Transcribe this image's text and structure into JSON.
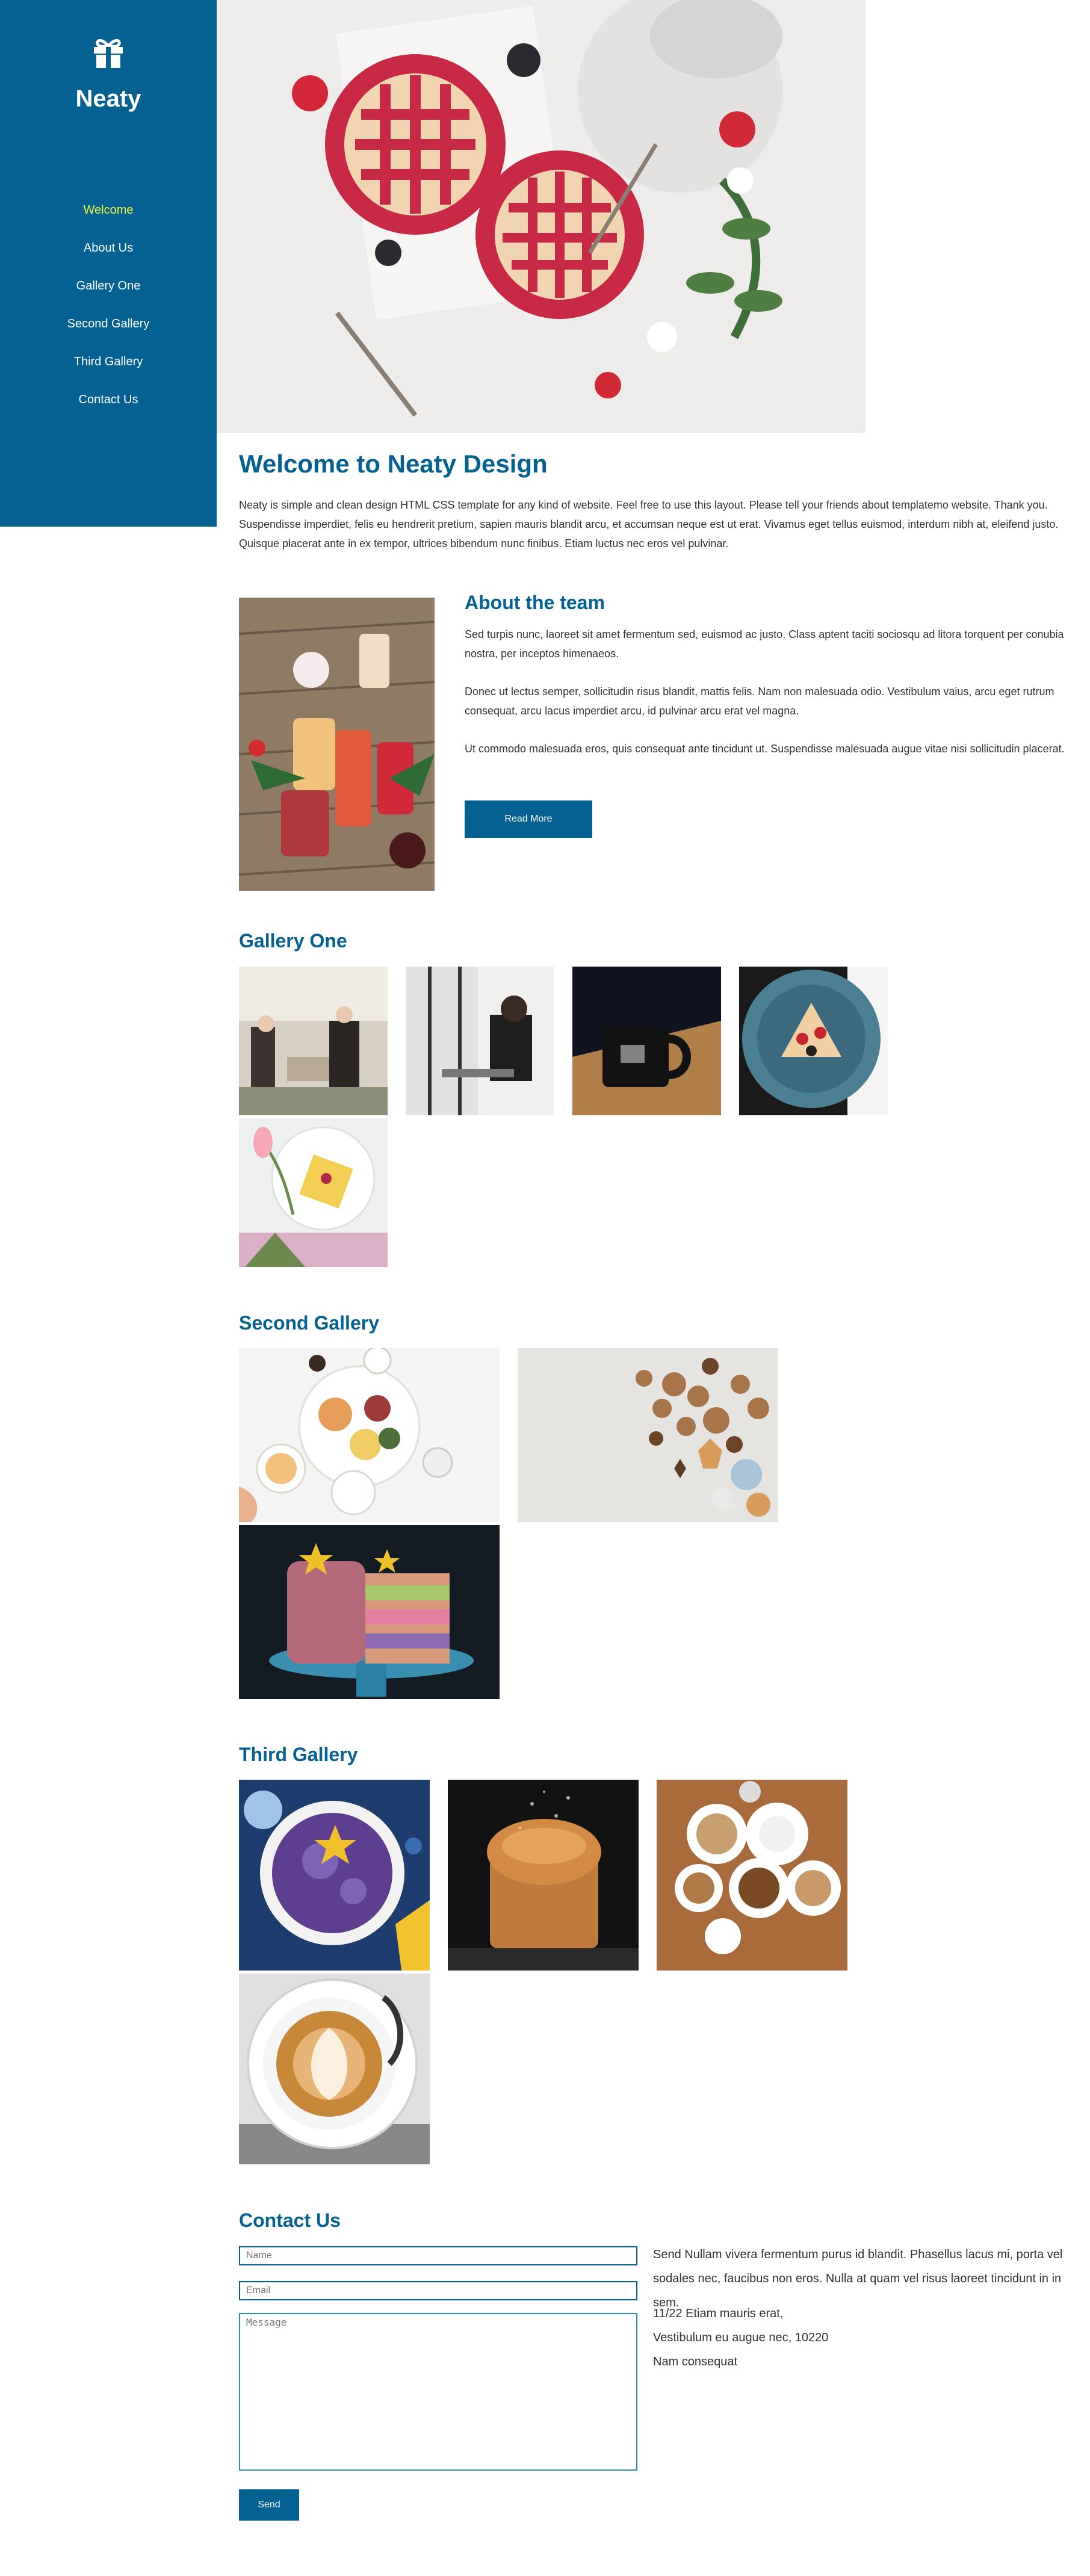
{
  "brand": {
    "name": "Neaty",
    "icon": "gift-icon"
  },
  "nav": [
    {
      "label": "Welcome",
      "active": true
    },
    {
      "label": "About Us"
    },
    {
      "label": "Gallery One"
    },
    {
      "label": "Second Gallery"
    },
    {
      "label": "Third Gallery"
    },
    {
      "label": "Contact Us"
    }
  ],
  "welcome": {
    "title": "Welcome to Neaty Design",
    "text": "Neaty is simple and clean design HTML CSS template for any kind of website. Feel free to use this layout. Please tell your friends about templatemo website. Thank you. Suspendisse imperdiet, felis eu hendrerit pretium, sapien mauris blandit arcu, et accumsan neque est ut erat. Vivamus eget tellus euismod, interdum nibh at, eleifend justo. Quisque placerat ante in ex tempor, ultrices bibendum nunc finibus. Etiam luctus nec eros vel pulvinar."
  },
  "about": {
    "title": "About the team",
    "p1": "Sed turpis nunc, laoreet sit amet fermentum sed, euismod ac justo. Class aptent taciti sociosqu ad litora torquent per conubia nostra, per inceptos himenaeos.",
    "p2": "Donec ut lectus semper, sollicitudin risus blandit, mattis felis. Nam non malesuada odio. Vestibulum vaius, arcu eget rutrum consequat, arcu lacus imperdiet arcu, id pulvinar arcu erat vel magna.",
    "p3": "Ut commodo malesuada eros, quis consequat ante tincidunt ut. Suspendisse malesuada augue vitae nisi sollicitudin placerat.",
    "button": "Read More"
  },
  "gallery_one": {
    "title": "Gallery One"
  },
  "gallery_two": {
    "title": "Second Gallery"
  },
  "gallery_three": {
    "title": "Third Gallery"
  },
  "contact": {
    "title": "Contact Us",
    "name_placeholder": "Name",
    "email_placeholder": "Email",
    "message_placeholder": "Message",
    "send": "Send",
    "text": "Send Nullam vivera fermentum purus id blandit. Phasellus lacus mi, porta vel sodales nec, faucibus non eros. Nulla at quam vel risus laoreet tincidunt in in sem.",
    "address1": "11/22 Etiam mauris erat,",
    "address2": "Vestibulum eu augue nec, 10220",
    "address3": "Nam consequat"
  },
  "colors": {
    "primary": "#046192",
    "active_nav": "#f2f23b"
  }
}
